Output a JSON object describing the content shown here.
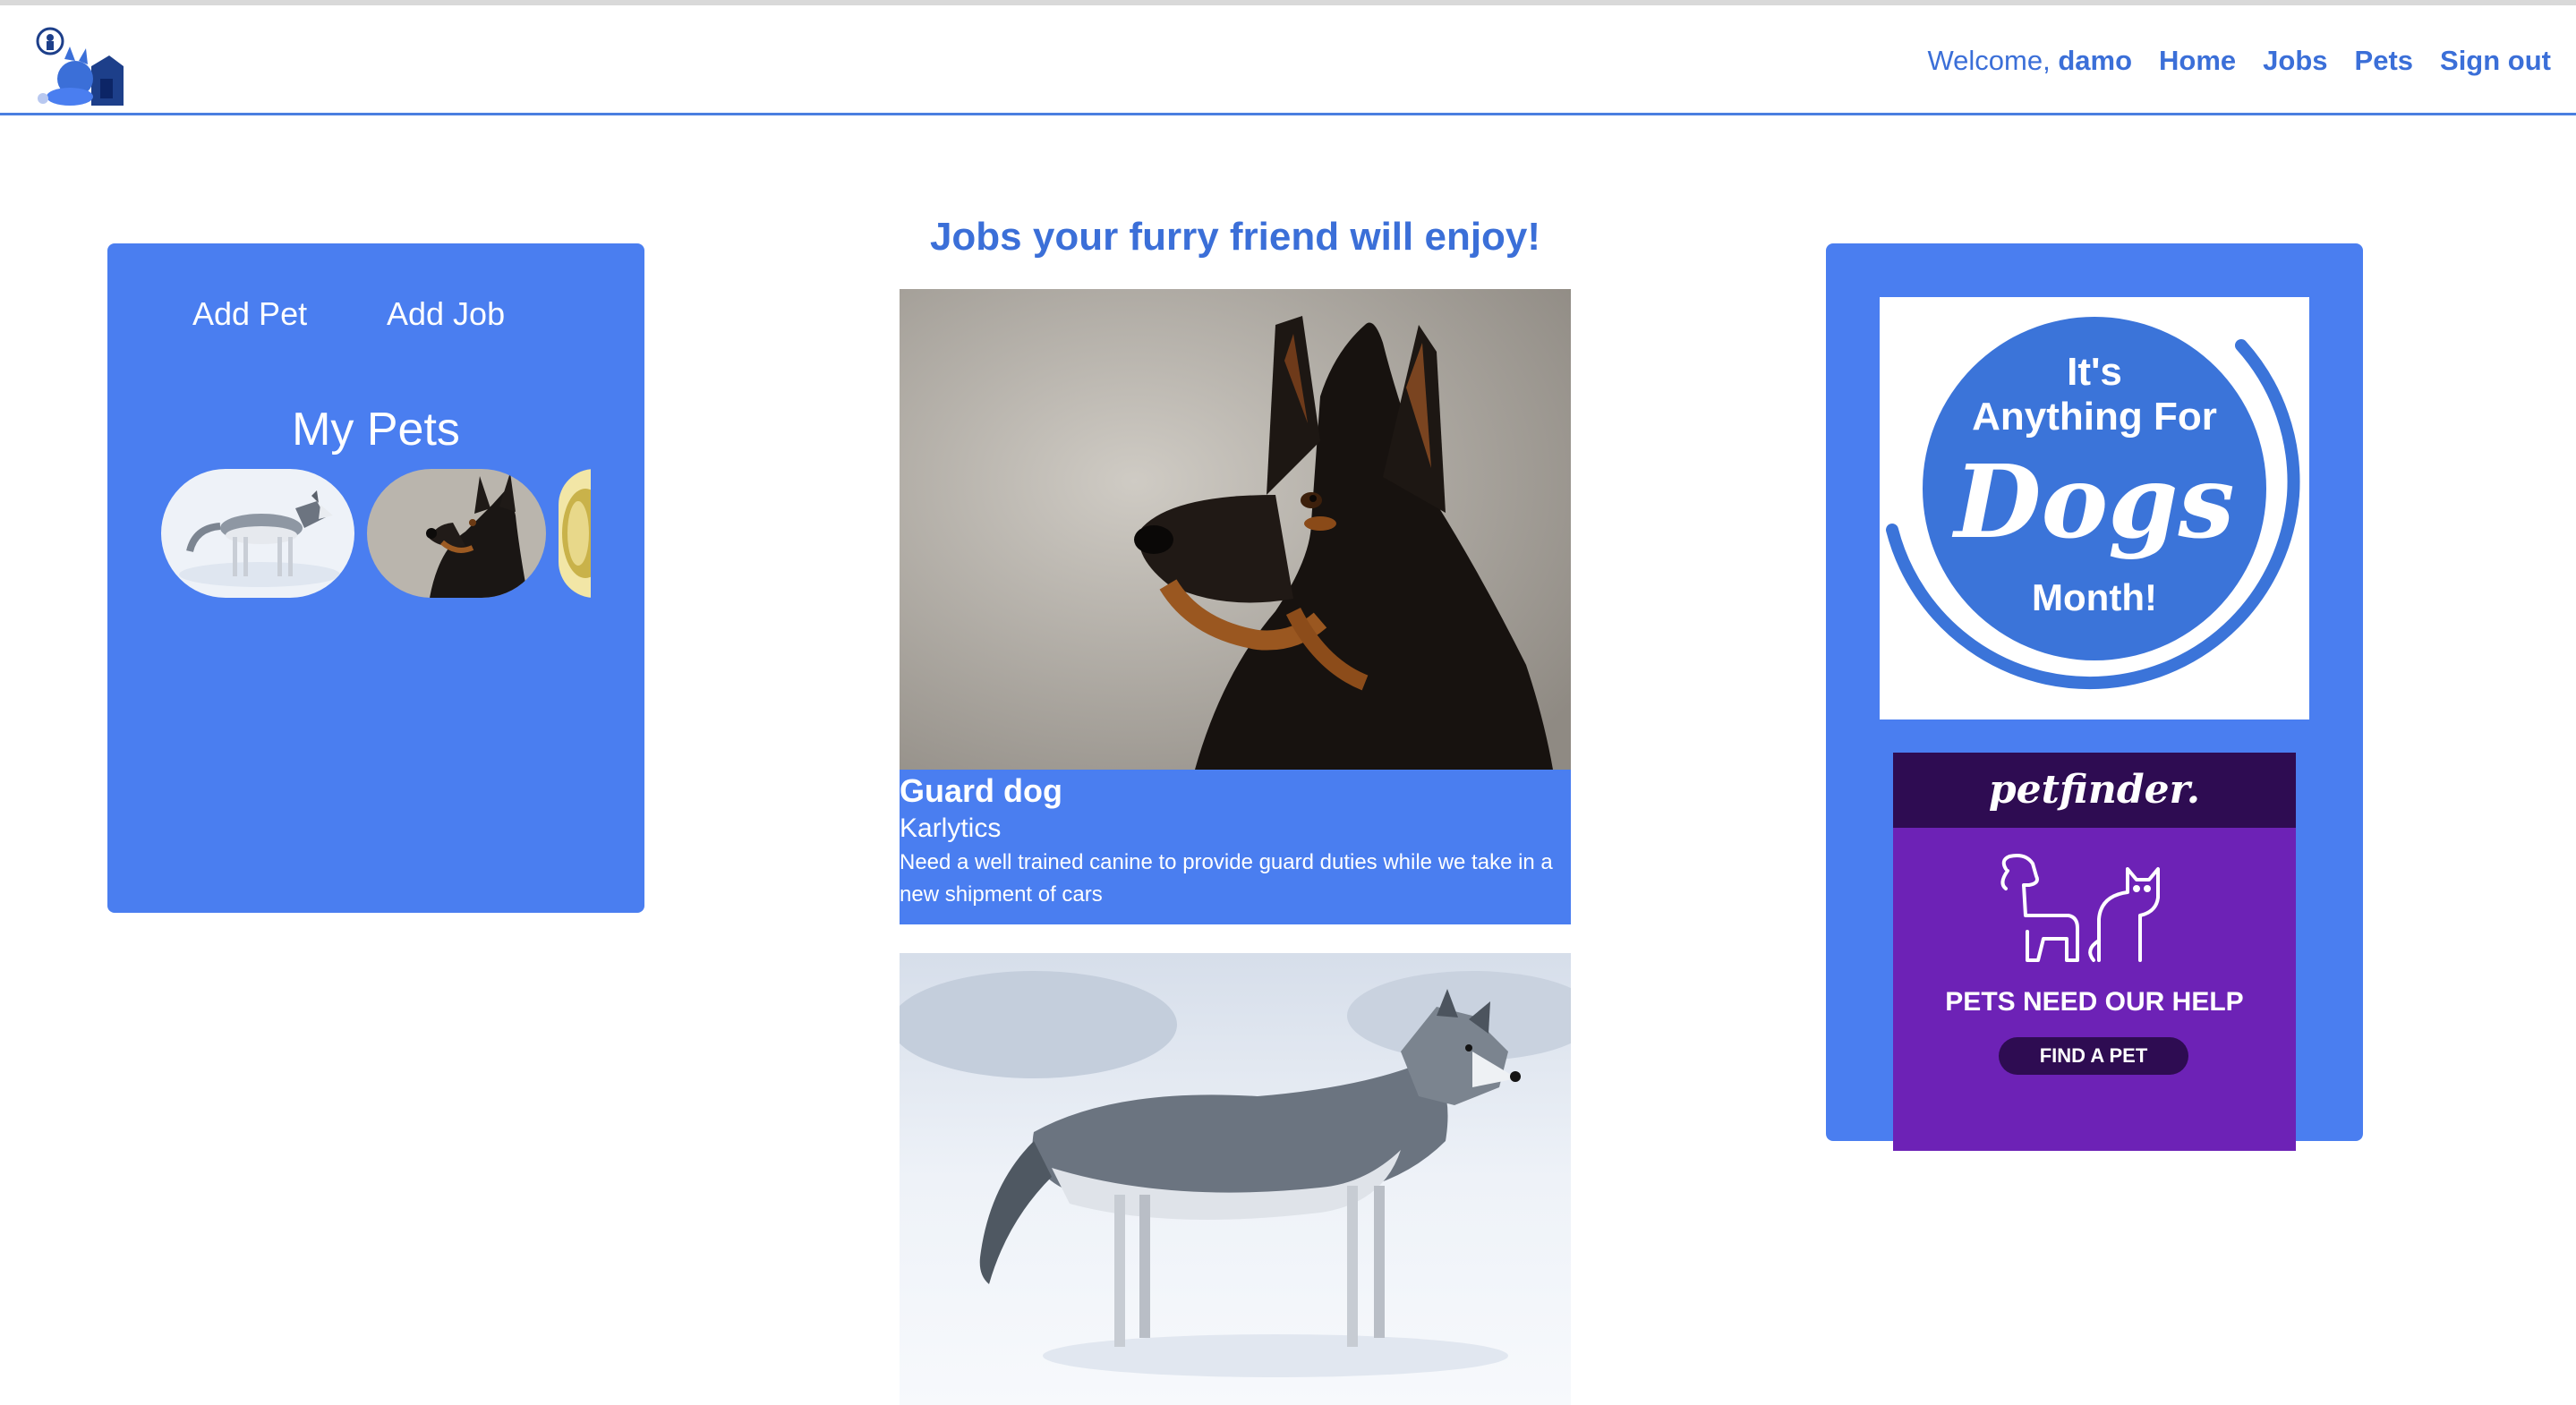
{
  "nav": {
    "welcome_prefix": "Welcome,",
    "username": "damo",
    "links": [
      "Home",
      "Jobs",
      "Pets",
      "Sign out"
    ]
  },
  "left_panel": {
    "add_pet": "Add Pet",
    "add_job": "Add Job",
    "my_pets_title": "My Pets",
    "pets": [
      "husky-photo",
      "doberman-photo",
      "yellow-partial-photo"
    ]
  },
  "main": {
    "title": "Jobs your furry friend will enjoy!",
    "jobs": [
      {
        "title": "Guard dog",
        "company": "Karlytics",
        "description": "Need a well trained canine to provide guard duties while we take in a new shipment of cars"
      }
    ]
  },
  "ads": {
    "ad1": {
      "line1": "It's",
      "line2": "Anything For",
      "line3": "Dogs",
      "line4": "Month!"
    },
    "ad2": {
      "brand": "petfinder.",
      "tagline": "PETS NEED OUR HELP",
      "button": "FIND A PET"
    }
  },
  "colors": {
    "accent": "#4a7ef0",
    "link": "#3b6fd8",
    "petfinder_purple": "#6d22b6",
    "petfinder_dark": "#2e0c52"
  }
}
